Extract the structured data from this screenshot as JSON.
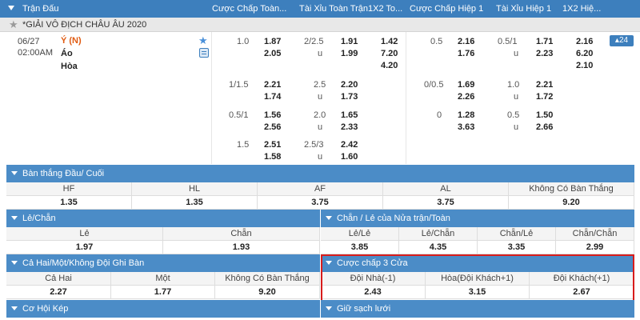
{
  "header": {
    "match": "Trận Đấu",
    "hdp_ft": "Cược Chấp Toàn...",
    "ou_ft": "Tài Xỉu Toàn Trận",
    "x12_ft": "1X2 To...",
    "hdp_h1": "Cược Chấp Hiệp 1",
    "ou_h1": "Tài Xỉu Hiệp 1",
    "x12_h1": "1X2 Hiệ..."
  },
  "league": {
    "name": "*GIẢI VÔ ĐỊCH CHÂU ÂU 2020"
  },
  "match": {
    "date": "06/27",
    "time": "02:00AM",
    "home": "Ý (N)",
    "away": "Áo",
    "draw_label": "Hòa",
    "more_count": "24"
  },
  "odds_lines": [
    {
      "hdp_ft": {
        "line": "1.0",
        "home": "1.87",
        "away": "2.05"
      },
      "ou_ft": {
        "line": "2/2.5",
        "u": "u",
        "over": "1.91",
        "under": "1.99"
      },
      "x12_ft": {
        "h": "1.42",
        "a": "7.20",
        "d": "4.20"
      },
      "hdp_h1": {
        "line": "0.5",
        "home": "2.16",
        "away": "1.76"
      },
      "ou_h1": {
        "line": "0.5/1",
        "u": "u",
        "over": "1.71",
        "under": "2.23"
      },
      "x12_h1": {
        "h": "2.16",
        "a": "6.20",
        "d": "2.10"
      }
    },
    {
      "hdp_ft": {
        "line": "1/1.5",
        "home": "2.21",
        "away": "1.74"
      },
      "ou_ft": {
        "line": "2.5",
        "u": "u",
        "over": "2.20",
        "under": "1.73"
      },
      "hdp_h1": {
        "line": "0/0.5",
        "home": "1.69",
        "away": "2.26"
      },
      "ou_h1": {
        "line": "1.0",
        "u": "u",
        "over": "2.21",
        "under": "1.72"
      }
    },
    {
      "hdp_ft": {
        "line": "0.5/1",
        "home": "1.56",
        "away": "2.56"
      },
      "ou_ft": {
        "line": "2.0",
        "u": "u",
        "over": "1.65",
        "under": "2.33"
      },
      "hdp_h1": {
        "line": "0",
        "home": "1.28",
        "away": "3.63"
      },
      "ou_h1": {
        "line": "0.5",
        "u": "u",
        "over": "1.50",
        "under": "2.66"
      }
    },
    {
      "hdp_ft": {
        "line": "1.5",
        "home": "2.51",
        "away": "1.58"
      },
      "ou_ft": {
        "line": "2.5/3",
        "u": "u",
        "over": "2.42",
        "under": "1.60"
      }
    }
  ],
  "panels": {
    "first_last": {
      "title": "Bàn thắng Đầu/ Cuối",
      "headers": [
        "HF",
        "HL",
        "AF",
        "AL",
        "Không Có Bàn Thắng"
      ],
      "values": [
        "1.35",
        "1.35",
        "3.75",
        "3.75",
        "9.20"
      ]
    },
    "odd_even": {
      "title": "Lẻ/Chẵn",
      "headers": [
        "Lẻ",
        "Chẵn"
      ],
      "values": [
        "1.97",
        "1.93"
      ]
    },
    "odd_even_ht_ft": {
      "title": "Chẵn / Lẻ của Nửa trận/Toàn",
      "headers": [
        "Lẻ/Lẻ",
        "Lẻ/Chẵn",
        "Chẵn/Lẻ",
        "Chẵn/Chẵn"
      ],
      "values": [
        "3.85",
        "4.35",
        "3.35",
        "2.99"
      ]
    },
    "both_one_none": {
      "title": "Cả Hai/Một/Không Đội Ghi Bàn",
      "headers": [
        "Cả Hai",
        "Một",
        "Không Có Bàn Thắng"
      ],
      "values": [
        "2.27",
        "1.77",
        "9.20"
      ]
    },
    "three_way_hdp": {
      "title": "Cược chấp 3 Cửa",
      "headers": [
        "Đội Nhà(-1)",
        "Hòa(Đội Khách+1)",
        "Đội Khách(+1)"
      ],
      "values": [
        "2.43",
        "3.15",
        "2.67"
      ]
    },
    "double_chance": {
      "title": "Cơ Hội Kép"
    },
    "clean_sheet": {
      "title": "Giữ sạch lưới"
    }
  },
  "colors": {
    "header": "#3d7fbd",
    "panel_title": "#4b8cc7",
    "home_team": "#e05a10",
    "highlight": "#d81c1c"
  }
}
